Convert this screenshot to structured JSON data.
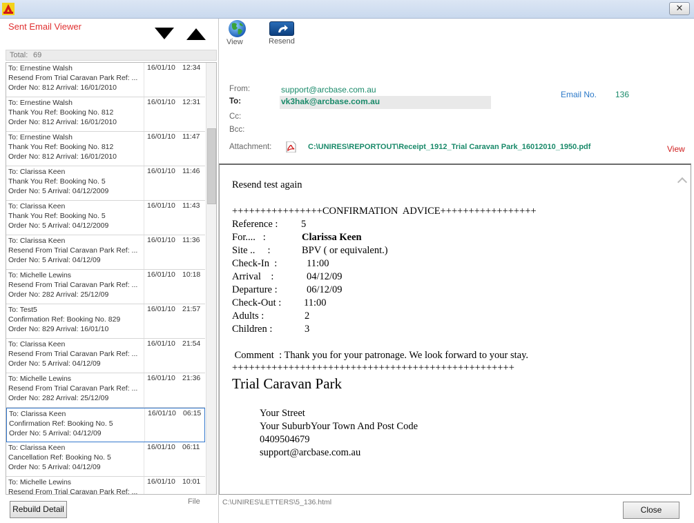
{
  "window": {
    "close_glyph": "✕"
  },
  "left": {
    "title": "Sent Email Viewer",
    "total_label": "Total:",
    "total_value": "69",
    "rows": [
      {
        "to": "To: Ernestine Walsh",
        "subject": "Resend From Trial Caravan Park Ref: ...",
        "order": "Order No: 812 Arrival: 16/01/2010",
        "date": "16/01/10",
        "time": "12:34"
      },
      {
        "to": "To: Ernestine Walsh",
        "subject": "Thank You Ref: Booking No. 812",
        "order": "Order No: 812 Arrival: 16/01/2010",
        "date": "16/01/10",
        "time": "12:31"
      },
      {
        "to": "To: Ernestine Walsh",
        "subject": "Thank You Ref: Booking No. 812",
        "order": "Order No: 812 Arrival: 16/01/2010",
        "date": "16/01/10",
        "time": "11:47"
      },
      {
        "to": "To: Clarissa Keen",
        "subject": "Thank You Ref: Booking No. 5",
        "order": "Order No: 5 Arrival: 04/12/2009",
        "date": "16/01/10",
        "time": "11:46"
      },
      {
        "to": "To: Clarissa Keen",
        "subject": "Thank You Ref: Booking No. 5",
        "order": "Order No: 5 Arrival: 04/12/2009",
        "date": "16/01/10",
        "time": "11:43"
      },
      {
        "to": "To: Clarissa Keen",
        "subject": "Resend From Trial Caravan Park Ref: ...",
        "order": "Order No: 5 Arrival: 04/12/09",
        "date": "16/01/10",
        "time": "11:36"
      },
      {
        "to": "To: Michelle Lewins",
        "subject": "Resend From Trial Caravan Park Ref: ...",
        "order": "Order No: 282 Arrival: 25/12/09",
        "date": "16/01/10",
        "time": "10:18"
      },
      {
        "to": "To:  Test5",
        "subject": "Confirmation Ref: Booking No. 829",
        "order": "Order No: 829 Arrival: 16/01/10",
        "date": "16/01/10",
        "time": "21:57"
      },
      {
        "to": "To: Clarissa Keen",
        "subject": "Resend From Trial Caravan Park Ref: ...",
        "order": "Order No: 5 Arrival: 04/12/09",
        "date": "16/01/10",
        "time": "21:54"
      },
      {
        "to": "To: Michelle Lewins",
        "subject": "Resend From Trial Caravan Park Ref: ...",
        "order": "Order No: 282 Arrival: 25/12/09",
        "date": "16/01/10",
        "time": "21:36"
      },
      {
        "to": "To: Clarissa Keen",
        "subject": "Confirmation Ref: Booking No. 5",
        "order": "Order No: 5 Arrival: 04/12/09",
        "date": "16/01/10",
        "time": "06:15",
        "selected": true
      },
      {
        "to": "To: Clarissa Keen",
        "subject": "Cancellation Ref: Booking No. 5",
        "order": "Order No: 5 Arrival: 04/12/09",
        "date": "16/01/10",
        "time": "06:11"
      },
      {
        "to": "To: Michelle Lewins",
        "subject": "Resend From Trial Caravan Park Ref: ...",
        "order": "",
        "date": "16/01/10",
        "time": "10:01"
      }
    ]
  },
  "toolbar": {
    "view_label": "View",
    "resend_label": "Resend"
  },
  "header": {
    "from_label": "From:",
    "from_value": "support@arcbase.com.au",
    "to_label": "To:",
    "to_value": "vk3hak@arcbase.com.au",
    "cc_label": "Cc:",
    "bcc_label": "Bcc:",
    "email_no_label": "Email No.",
    "email_no_value": "136",
    "attachment_label": "Attachment:",
    "attachment_value": "C:\\UNIRES\\REPORTOUT\\Receipt_1912_Trial Caravan Park_16012010_1950.pdf",
    "attachment_view": "View"
  },
  "body": {
    "intro": "Resend test again",
    "banner": "++++++++++++++++CONFIRMATION  ADVICE+++++++++++++++++",
    "fields": [
      {
        "label": "Reference :",
        "value": "5",
        "bold": false
      },
      {
        "label": "For....   :",
        "value": "Clarissa Keen",
        "bold": true
      },
      {
        "label": "Site ..     :",
        "value": "BPV ( or equivalent.)",
        "bold": false
      },
      {
        "label": "Check-In  :",
        "value": "11:00",
        "bold": false
      },
      {
        "label": "Arrival    :",
        "value": "04/12/09",
        "bold": false
      },
      {
        "label": "Departure :",
        "value": "06/12/09",
        "bold": false
      },
      {
        "label": "Check-Out :",
        "value": "11:00",
        "bold": false
      },
      {
        "label": "Adults :",
        "value": "2",
        "bold": false
      },
      {
        "label": "Children :",
        "value": "3",
        "bold": false
      }
    ],
    "comment": " Comment  : Thank you for your patronage. We look forward to your stay.",
    "divider": "++++++++++++++++++++++++++++++++++++++++++++++++++",
    "park_name": "Trial Caravan Park",
    "address": [
      "Your Street",
      "Your SuburbYour Town And Post Code",
      "0409504679",
      "support@arcbase.com.au"
    ]
  },
  "footer": {
    "rebuild_label": "Rebuild Detail",
    "file_label": "File",
    "file_path": "C:\\UNIRES\\LETTERS\\5_136.html",
    "close_label": "Close"
  }
}
